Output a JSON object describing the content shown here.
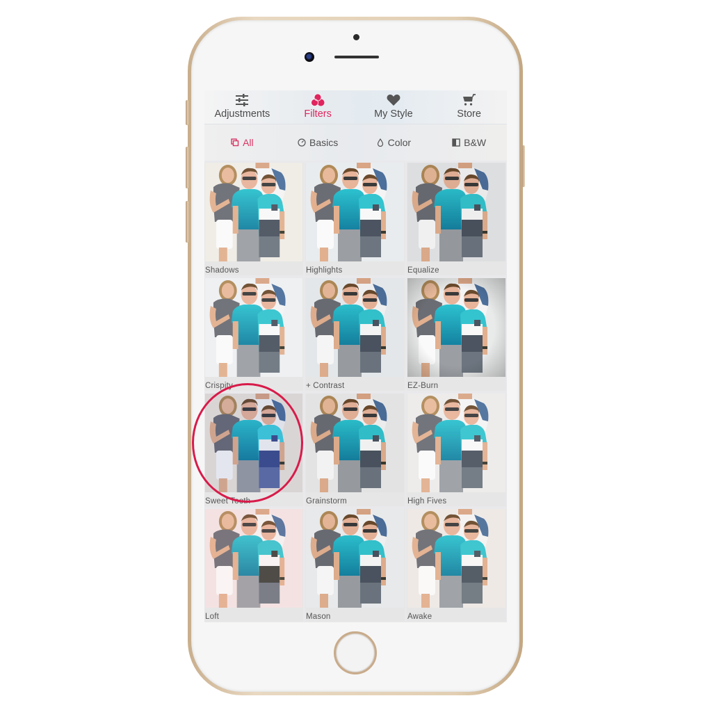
{
  "app": {
    "tabs": [
      {
        "label": "Adjustments",
        "icon": "sliders-icon",
        "active": false
      },
      {
        "label": "Filters",
        "icon": "filters-icon",
        "active": true
      },
      {
        "label": "My Style",
        "icon": "heart-icon",
        "active": false
      },
      {
        "label": "Store",
        "icon": "cart-icon",
        "active": false
      }
    ],
    "subtabs": [
      {
        "label": "All",
        "icon": "copy-icon",
        "active": true
      },
      {
        "label": "Basics",
        "icon": "dial-icon",
        "active": false
      },
      {
        "label": "Color",
        "icon": "drop-icon",
        "active": false
      },
      {
        "label": "B&W",
        "icon": "half-square-icon",
        "active": false
      }
    ],
    "filters": [
      {
        "label": "Shadows",
        "tint": "#f0ece6",
        "overlay": "rgba(255,255,255,0.05)"
      },
      {
        "label": "Highlights",
        "tint": "#e9ecee",
        "overlay": "rgba(255,255,255,0.0)"
      },
      {
        "label": "Equalize",
        "tint": "#e7e8ea",
        "overlay": "rgba(0,0,0,0.04)"
      },
      {
        "label": "Crispity",
        "tint": "#eef0f2",
        "overlay": "rgba(255,255,255,0.05)"
      },
      {
        "label": "+ Contrast",
        "tint": "#e8ecef",
        "overlay": "rgba(0,0,0,0.02)"
      },
      {
        "label": "EZ-Burn",
        "tint": "#e9eaea",
        "overlay": "rgba(0,0,0,0.25)"
      },
      {
        "label": "Sweet Tooth",
        "tint": "#efe7dd",
        "overlay": "rgba(40,60,150,0.10)"
      },
      {
        "label": "Grainstorm",
        "tint": "#ebebeb",
        "overlay": "rgba(0,0,0,0.03)"
      },
      {
        "label": "High Fives",
        "tint": "#ecebea",
        "overlay": "rgba(255,255,255,0.06)"
      },
      {
        "label": "Loft",
        "tint": "#f3e6e6",
        "overlay": "rgba(255,200,200,0.10)"
      },
      {
        "label": "Mason",
        "tint": "#eceeef",
        "overlay": "rgba(0,0,0,0.02)"
      },
      {
        "label": "Awake",
        "tint": "#ede9e6",
        "overlay": "rgba(255,230,220,0.06)"
      }
    ],
    "highlighted_filter": "Sweet Tooth",
    "accent_color": "#e0245e"
  }
}
